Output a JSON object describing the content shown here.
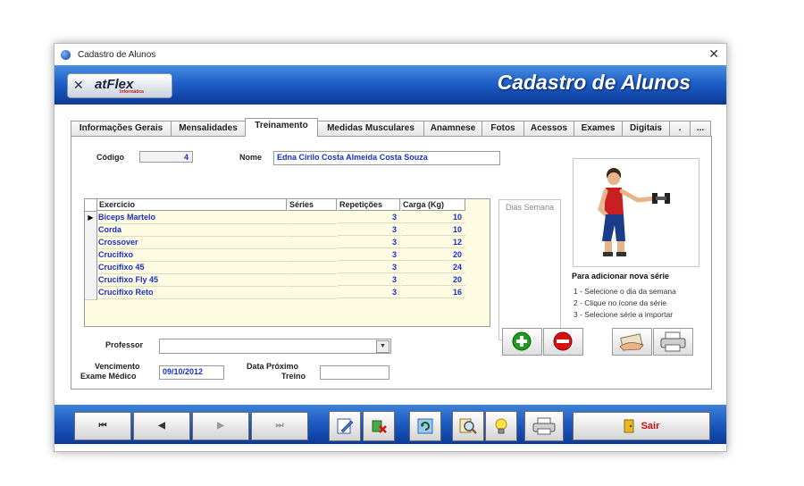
{
  "window": {
    "title": "Cadastro de Alunos",
    "close_glyph": "✕"
  },
  "header": {
    "logo_brand": "atFlex",
    "logo_sub": "Informática",
    "title": "Cadastro de Alunos"
  },
  "tabs": [
    {
      "label": "Informações Gerais"
    },
    {
      "label": "Mensalidades"
    },
    {
      "label": "Treinamento"
    },
    {
      "label": "Medidas Musculares"
    },
    {
      "label": "Anamnese"
    },
    {
      "label": "Fotos"
    },
    {
      "label": "Acessos"
    },
    {
      "label": "Exames"
    },
    {
      "label": "Digitais"
    },
    {
      "label": "."
    },
    {
      "label": "..."
    }
  ],
  "form": {
    "codigo_label": "Código",
    "codigo_value": "4",
    "nome_label": "Nome",
    "nome_value": "Edna Cirilo Costa Almeida Costa Souza",
    "professor_label": "Professor",
    "professor_value": "",
    "vencimento_label_1": "Vencimento",
    "vencimento_label_2": "Exame Médico",
    "vencimento_value": "09/10/2012",
    "proximo_label_1": "Data Próximo",
    "proximo_label_2": "Treino",
    "proximo_value": ""
  },
  "grid": {
    "headers": [
      "Exercicio",
      "Séries",
      "Repetições",
      "Carga (Kg)"
    ],
    "rows": [
      {
        "exercicio": "Biceps Martelo",
        "series": "",
        "repeticoes": "3",
        "carga": "10"
      },
      {
        "exercicio": "Corda",
        "series": "",
        "repeticoes": "3",
        "carga": "10"
      },
      {
        "exercicio": "Crossover",
        "series": "",
        "repeticoes": "3",
        "carga": "12"
      },
      {
        "exercicio": "Crucifixo",
        "series": "",
        "repeticoes": "3",
        "carga": "20"
      },
      {
        "exercicio": "Crucifixo 45",
        "series": "",
        "repeticoes": "3",
        "carga": "24"
      },
      {
        "exercicio": "Crucifixo Fly 45",
        "series": "",
        "repeticoes": "3",
        "carga": "20"
      },
      {
        "exercicio": "Crucifixo Reto",
        "series": "",
        "repeticoes": "3",
        "carga": "16"
      }
    ],
    "selected_row_marker": "▶"
  },
  "dias": {
    "label": "Dias Semana"
  },
  "hints": {
    "title": "Para adicionar nova série",
    "steps": [
      "1 - Selecione o dia da semana",
      "2 - Clique no ícone da série",
      "3 - Selecione série a importar"
    ]
  },
  "footer": {
    "first_glyph": "⏮",
    "prev_glyph": "◀",
    "next_glyph": "▶",
    "last_glyph": "⏭",
    "sair_label": "Sair"
  },
  "colors": {
    "header_blue": "#1e5fc8",
    "value_text": "#1a30c8",
    "grid_background": "#fdfbe2",
    "add_green": "#1e9a1e",
    "remove_red": "#d81010",
    "sair_red": "#c81010"
  },
  "icons": {
    "add": "plus-circle-icon",
    "remove": "minus-circle-icon",
    "copy_series": "hand-card-icon",
    "print_series": "printer-icon",
    "edit": "edit-icon",
    "delete": "delete-icon",
    "refresh": "refresh-icon",
    "search": "magnifier-icon",
    "idea": "lightbulb-icon",
    "print": "printer-icon",
    "exit": "door-exit-icon"
  }
}
